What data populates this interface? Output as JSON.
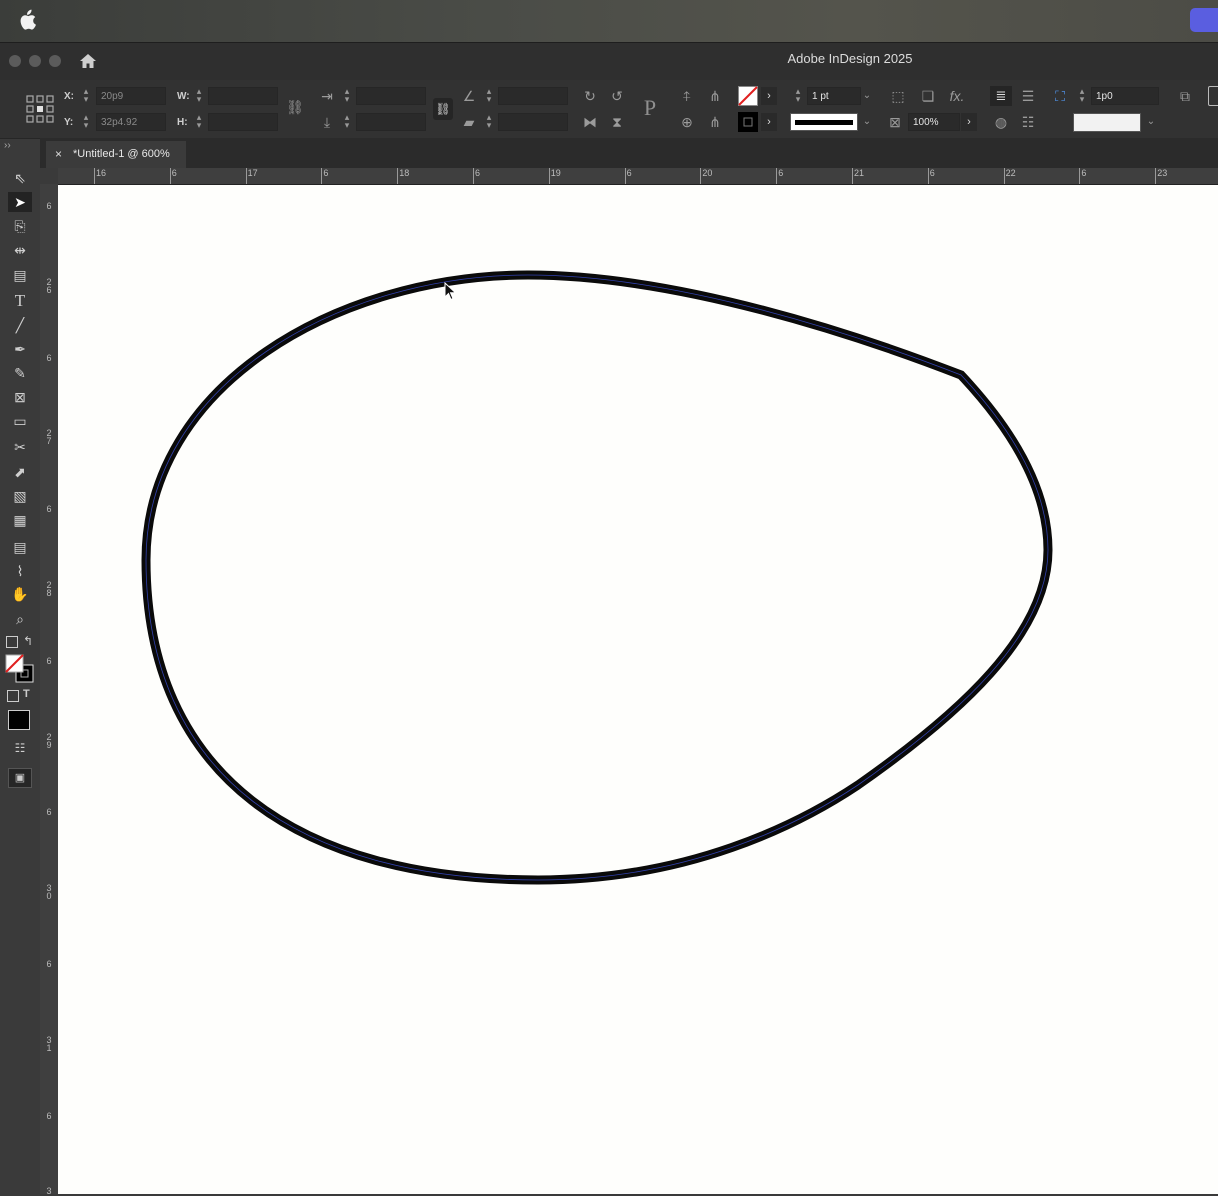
{
  "app": {
    "title": "Adobe InDesign 2025"
  },
  "document": {
    "tab_label": "*Untitled-1 @ 600%",
    "close_symbol": "×"
  },
  "control_panel": {
    "x_label": "X:",
    "x_value": "20p9",
    "y_label": "Y:",
    "y_value": "32p4.92",
    "w_label": "W:",
    "h_label": "H:",
    "stroke_weight": "1 pt",
    "opacity": "100%",
    "offset_value": "1p0"
  },
  "rulers": {
    "horizontal_ticks": [
      "16",
      "6",
      "17",
      "6",
      "18",
      "6",
      "19",
      "6",
      "20",
      "6",
      "21",
      "6",
      "22",
      "6",
      "23"
    ],
    "vertical_ticks": [
      [
        "6"
      ],
      [
        "2",
        "6"
      ],
      [
        "6"
      ],
      [
        "2",
        "7"
      ],
      [
        "6"
      ],
      [
        "2",
        "8"
      ],
      [
        "6"
      ],
      [
        "2",
        "9"
      ],
      [
        "6"
      ],
      [
        "3",
        "0"
      ],
      [
        "6"
      ],
      [
        "3",
        "1"
      ],
      [
        "6"
      ],
      [
        "3"
      ]
    ]
  },
  "colors": {
    "accent": "#5a5ee0",
    "canvas": "#fefefc",
    "path_stroke": "#0a0a0a",
    "selection": "#3b4fd6"
  }
}
